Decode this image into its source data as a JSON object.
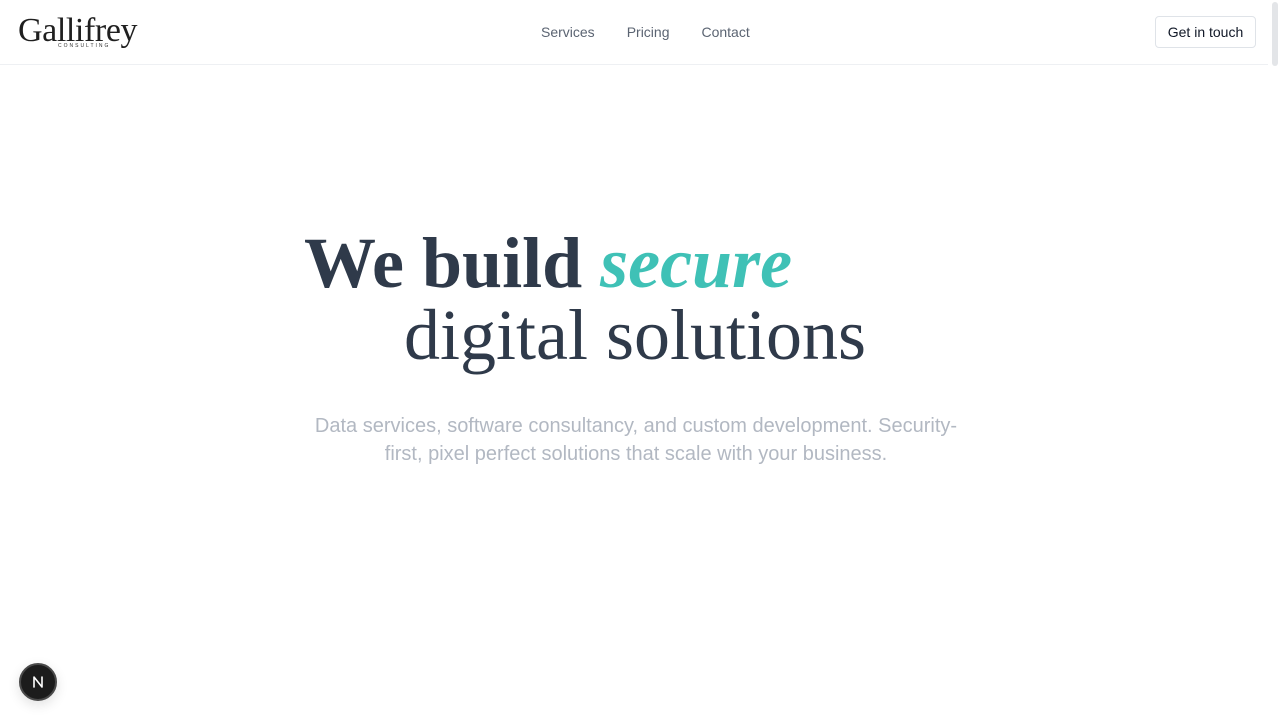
{
  "header": {
    "logo": {
      "wordmark": "Gallifrey",
      "subline": "CONSULTING"
    },
    "nav": {
      "items": [
        {
          "label": "Services"
        },
        {
          "label": "Pricing"
        },
        {
          "label": "Contact"
        }
      ]
    },
    "cta_label": "Get in touch"
  },
  "hero": {
    "headline_part1": "We build ",
    "headline_accent": "secure",
    "headline_line2": "digital solutions",
    "subtext": "Data services, software consultancy, and custom development. Security-first, pixel perfect solutions that scale with your business."
  },
  "badge": {
    "icon": "nextjs-n-icon"
  },
  "colors": {
    "accent": "#3fc1b6",
    "heading": "#2f3a4a",
    "muted_text": "#b2b8c2",
    "nav_text": "#5b6472"
  }
}
